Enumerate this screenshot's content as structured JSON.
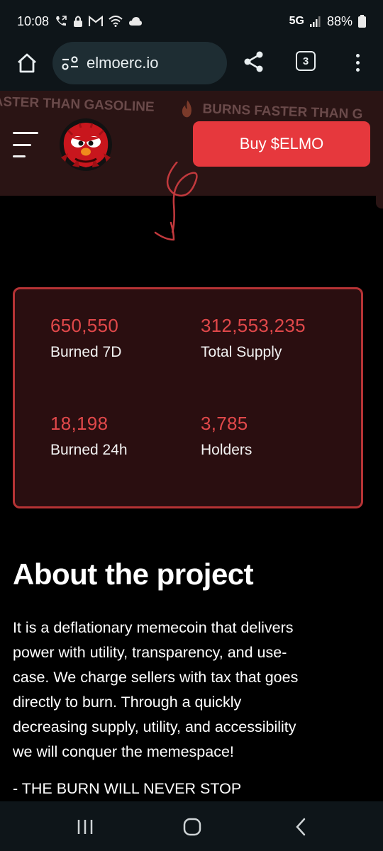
{
  "status_bar": {
    "time": "10:08",
    "network": "5G",
    "battery": "88%"
  },
  "browser": {
    "url": "elmoerc.io",
    "tab_count": "3"
  },
  "header": {
    "ticker": [
      "FASTER THAN GASOLINE",
      "BURNS FASTER THAN G"
    ],
    "buy_label": "Buy $ELMO",
    "accent_color": "#e6383d"
  },
  "stats": {
    "items": [
      {
        "value": "650,550",
        "label": "Burned 7D"
      },
      {
        "value": "312,553,235",
        "label": "Total Supply"
      },
      {
        "value": "18,198",
        "label": "Burned 24h"
      },
      {
        "value": "3,785",
        "label": "Holders"
      }
    ]
  },
  "about": {
    "title": "About the project",
    "lines": [
      "It is a deflationary memecoin that delivers",
      "power with utility, transparency, and use-",
      "case. We charge sellers with tax that goes",
      "directly to burn. Through a quickly",
      "decreasing supply, utility, and accessibility",
      "we will conquer the memespace!"
    ],
    "slogan": "- THE BURN WILL NEVER STOP"
  },
  "icons": {
    "status_left": [
      "call-forwarding-icon",
      "lock-icon",
      "gmail-icon",
      "wifi-icon",
      "cloud-icon"
    ],
    "status_right": [
      "signal-icon",
      "battery-icon"
    ],
    "browser": [
      "home-icon",
      "site-settings-icon",
      "share-icon",
      "tabs-icon",
      "more-icon"
    ],
    "nav": [
      "recents-icon",
      "home-icon",
      "back-icon"
    ]
  }
}
